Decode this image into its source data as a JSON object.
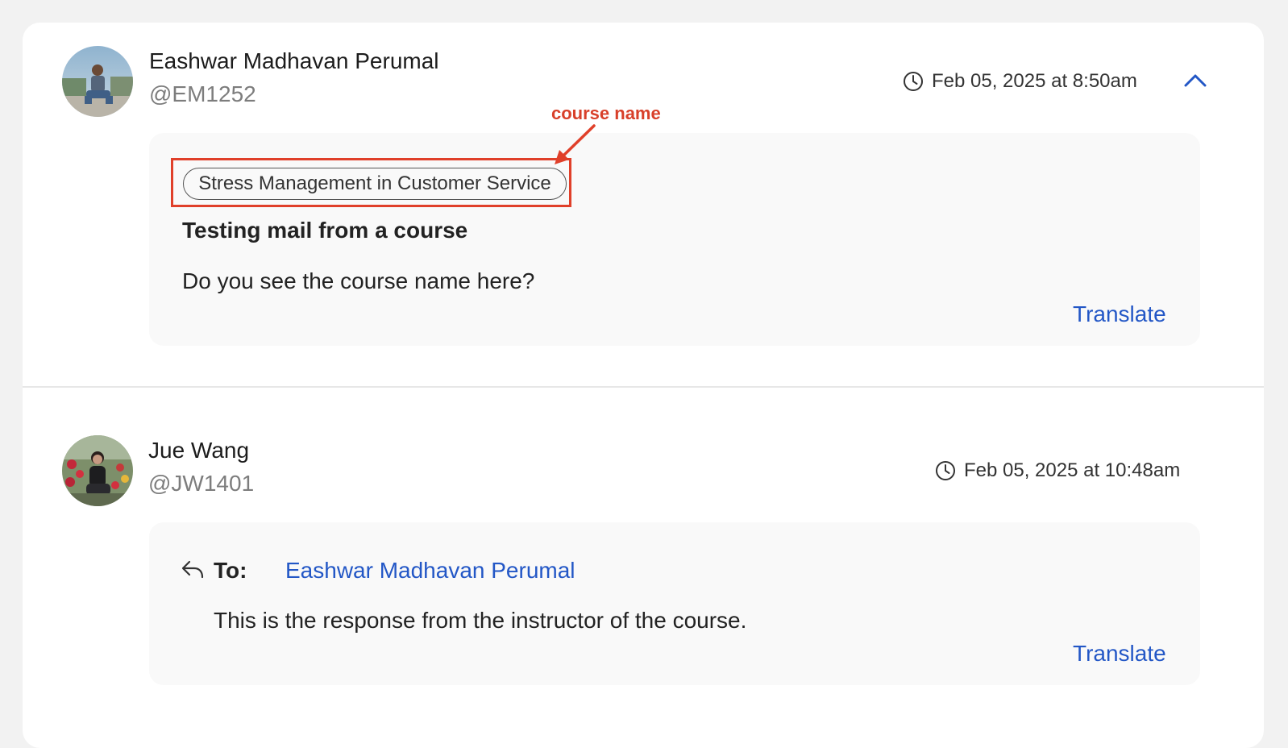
{
  "messages": [
    {
      "sender_name": "Eashwar Madhavan Perumal",
      "sender_handle": "@EM1252",
      "timestamp": "Feb 05, 2025 at 8:50am",
      "course_tag": "Stress Management in Customer Service",
      "subject": "Testing mail from a course",
      "body": "Do you see the course name here?",
      "translate_label": "Translate"
    },
    {
      "sender_name": "Jue Wang",
      "sender_handle": "@JW1401",
      "timestamp": "Feb 05, 2025 at 10:48am",
      "to_label": "To:",
      "to_name": "Eashwar Madhavan Perumal",
      "body": "This is the response from the instructor of the course.",
      "translate_label": "Translate"
    }
  ],
  "annotation": {
    "label": "course name",
    "color": "#d8402a"
  },
  "colors": {
    "link": "#2357c6",
    "highlight_border": "#e0402a",
    "bubble_bg": "#f9f9f9"
  },
  "icons": {
    "clock": "clock-icon",
    "collapse": "chevron-up-icon",
    "reply": "reply-icon"
  }
}
